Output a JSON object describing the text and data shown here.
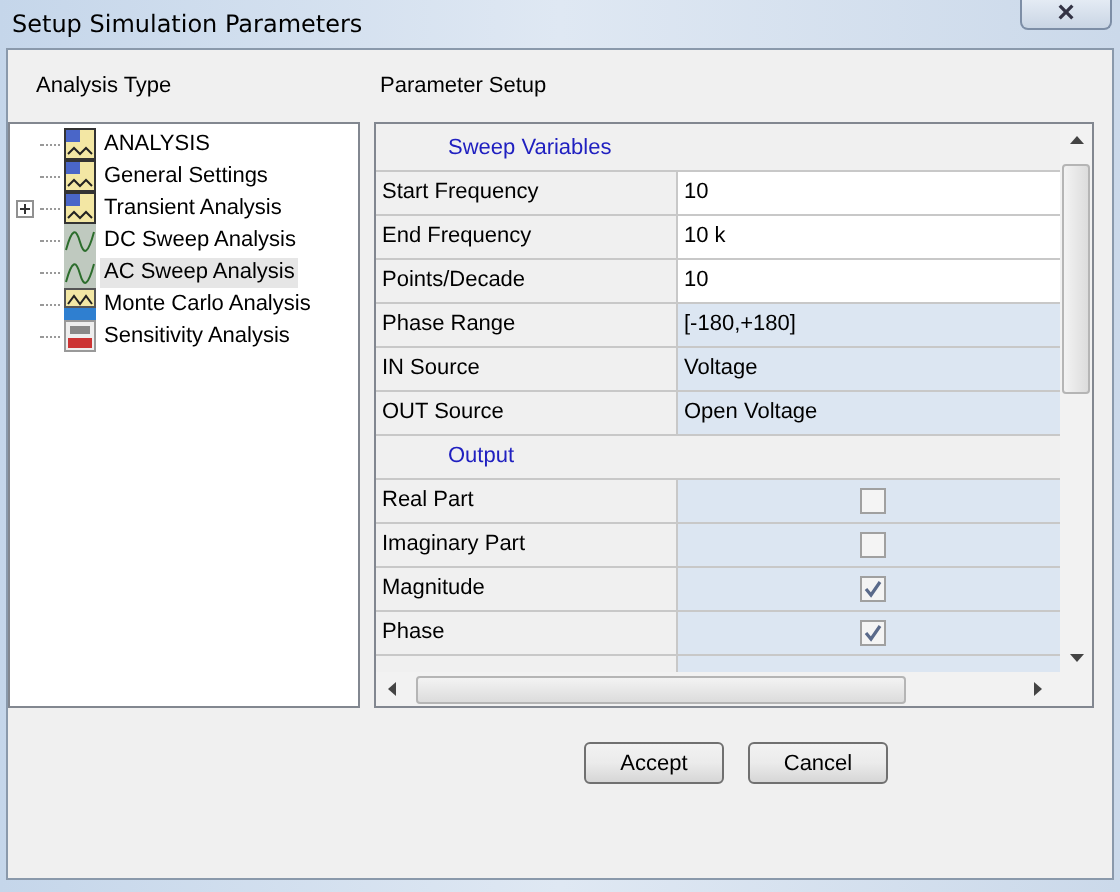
{
  "window": {
    "title": "Setup Simulation Parameters",
    "close_glyph": "×"
  },
  "analysis_type": {
    "heading": "Analysis Type",
    "items": [
      {
        "label": "ANALYSIS",
        "kind": "analysis",
        "expandable": false,
        "selected": false
      },
      {
        "label": "General Settings",
        "kind": "analysis",
        "expandable": false,
        "selected": false
      },
      {
        "label": "Transient Analysis",
        "kind": "analysis",
        "expandable": true,
        "selected": false
      },
      {
        "label": "DC Sweep Analysis",
        "kind": "curve",
        "expandable": false,
        "selected": false
      },
      {
        "label": "AC Sweep Analysis",
        "kind": "curve",
        "expandable": false,
        "selected": true
      },
      {
        "label": "Monte Carlo Analysis",
        "kind": "montecarlo",
        "expandable": false,
        "selected": false
      },
      {
        "label": "Sensitivity Analysis",
        "kind": "sensitivity",
        "expandable": false,
        "selected": false
      }
    ]
  },
  "parameter_setup": {
    "heading": "Parameter Setup",
    "rows": [
      {
        "kind": "section",
        "label": "Sweep Variables"
      },
      {
        "kind": "text",
        "label": "Start Frequency",
        "value": "10",
        "editable": true
      },
      {
        "kind": "text",
        "label": "End Frequency",
        "value": "10 k",
        "editable": true
      },
      {
        "kind": "text",
        "label": "Points/Decade",
        "value": "10",
        "editable": true
      },
      {
        "kind": "text",
        "label": "Phase Range",
        "value": "[-180,+180]",
        "editable": false
      },
      {
        "kind": "text",
        "label": "IN Source",
        "value": "Voltage",
        "editable": false
      },
      {
        "kind": "text",
        "label": "OUT Source",
        "value": "Open Voltage",
        "editable": false
      },
      {
        "kind": "section",
        "label": "Output"
      },
      {
        "kind": "check",
        "label": "Real Part",
        "checked": false
      },
      {
        "kind": "check",
        "label": "Imaginary Part",
        "checked": false
      },
      {
        "kind": "check",
        "label": "Magnitude",
        "checked": true
      },
      {
        "kind": "check",
        "label": "Phase",
        "checked": true
      },
      {
        "kind": "blank"
      }
    ]
  },
  "buttons": [
    "Accept",
    "Cancel"
  ]
}
